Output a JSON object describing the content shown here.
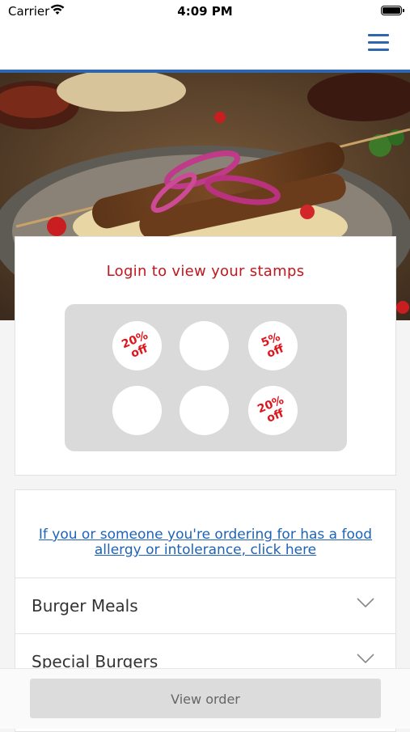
{
  "status_bar": {
    "carrier": "Carrier",
    "time": "4:09 PM"
  },
  "header": {
    "menu_icon": "hamburger-menu-icon",
    "accent_color": "#2f66b0"
  },
  "stamps": {
    "login_prompt": "Login to view your stamps",
    "items": [
      {
        "line1": "20%",
        "line2": "off"
      },
      {
        "line1": "",
        "line2": ""
      },
      {
        "line1": "5%",
        "line2": "off"
      },
      {
        "line1": "",
        "line2": ""
      },
      {
        "line1": "",
        "line2": ""
      },
      {
        "line1": "20%",
        "line2": "off"
      }
    ]
  },
  "allergy": {
    "line1": "If you or someone you're ordering for has a food",
    "line2": "allergy or intolerance, click here"
  },
  "menu": {
    "categories": [
      {
        "label": "Burger Meals"
      },
      {
        "label": "Special Burgers"
      }
    ]
  },
  "bottom": {
    "view_order_label": "View order"
  }
}
